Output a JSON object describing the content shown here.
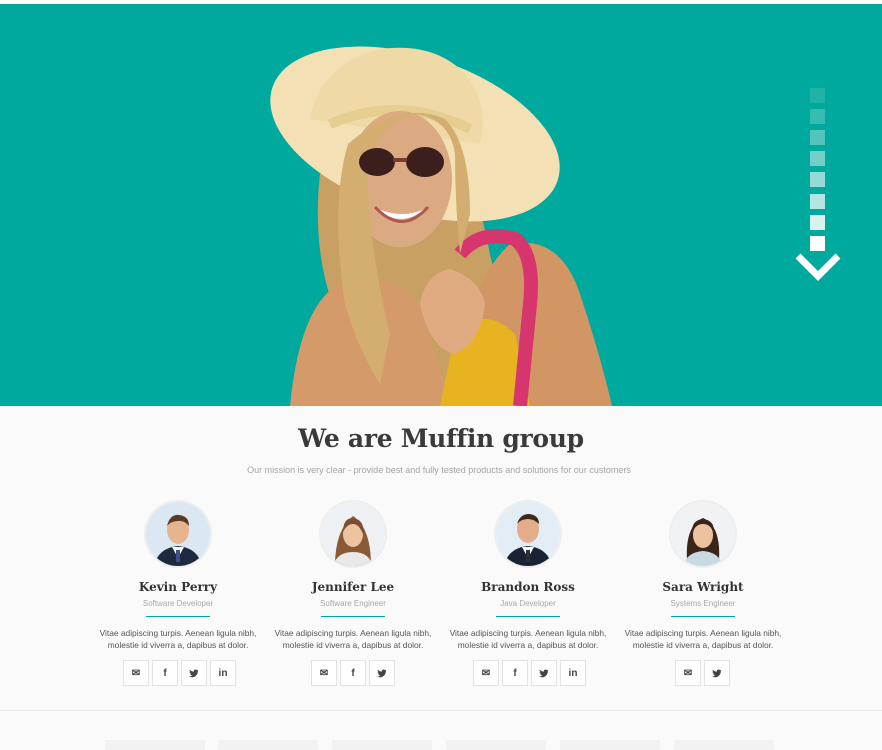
{
  "hero": {
    "background_color": "#00a99d",
    "photo": "woman-in-sun-hat-photo",
    "scroll_icon": "down-arrow-icon"
  },
  "about": {
    "title": "We are Muffin group",
    "subtitle": "Our mission is very clear - provide best and fully tested products and solutions for our customers"
  },
  "team": [
    {
      "name": "Kevin Perry",
      "role": "Software Developer",
      "desc_line1": "Vitae adipiscing turpis. Aenean ligula nibh,",
      "desc_line2": "molestie id viverra a, dapibus at dolor.",
      "social": [
        "mail-icon",
        "facebook-icon",
        "twitter-icon",
        "linkedin-icon"
      ]
    },
    {
      "name": "Jennifer Lee",
      "role": "Software Engineer",
      "desc_line1": "Vitae adipiscing turpis. Aenean ligula nibh,",
      "desc_line2": "molestie id viverra a, dapibus at dolor.",
      "social": [
        "mail-icon",
        "facebook-icon",
        "twitter-icon"
      ]
    },
    {
      "name": "Brandon Ross",
      "role": "Java Developer",
      "desc_line1": "Vitae adipiscing turpis. Aenean ligula nibh,",
      "desc_line2": "molestie id viverra a, dapibus at dolor.",
      "social": [
        "mail-icon",
        "facebook-icon",
        "twitter-icon",
        "linkedin-icon"
      ]
    },
    {
      "name": "Sara Wright",
      "role": "Systems Engineer",
      "desc_line1": "Vitae adipiscing turpis. Aenean ligula nibh,",
      "desc_line2": "molestie id viverra a, dapibus at dolor.",
      "social": [
        "mail-icon",
        "twitter-icon"
      ]
    }
  ],
  "social_glyphs": {
    "mail-icon": "✉",
    "facebook-icon": "f",
    "twitter-icon": "🐦",
    "linkedin-icon": "in"
  },
  "accent_color": "#00a99d"
}
